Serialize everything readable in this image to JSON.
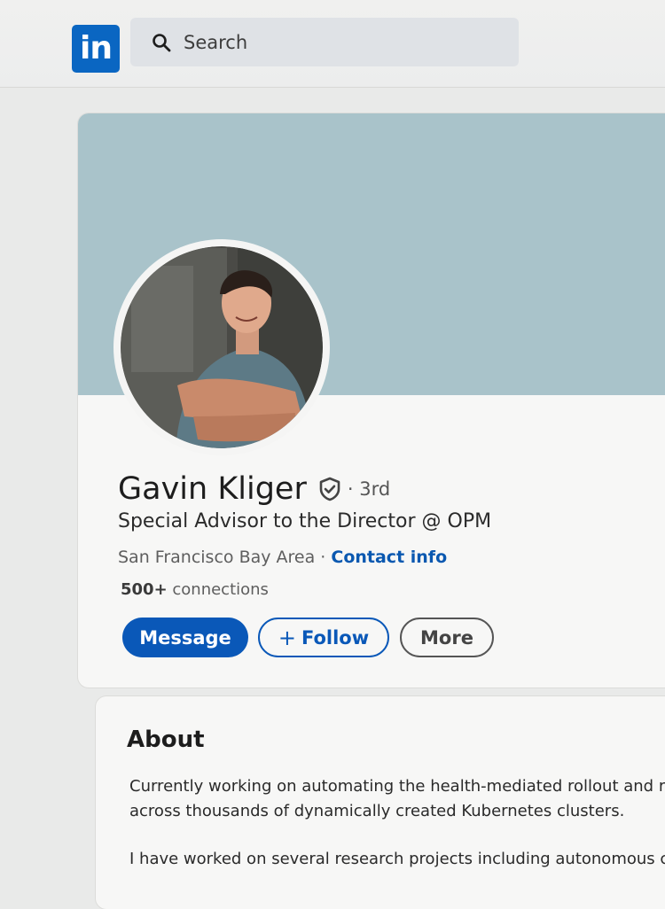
{
  "header": {
    "logo_text": "in",
    "search_placeholder": "Search"
  },
  "profile": {
    "name": "Gavin Kliger",
    "degree": "· 3rd",
    "headline": "Special Advisor to the Director @ OPM",
    "location": "San Francisco Bay Area",
    "separator": " · ",
    "contact_info": "Contact info",
    "connections_count": "500+",
    "connections_label": " connections",
    "actions": {
      "message": "Message",
      "follow": "Follow",
      "follow_icon": "+",
      "more": "More"
    }
  },
  "about": {
    "title": "About",
    "line1": "Currently working on automating the health-mediated rollout and r",
    "line2": "across thousands of dynamically created Kubernetes clusters.",
    "line3": "I have worked on several research projects including autonomous cl"
  },
  "colors": {
    "brand": "#0a66c2",
    "link": "#0a58b0",
    "banner": "#a9c3ca"
  },
  "icons": [
    "linkedin-logo",
    "search-icon",
    "verified-shield-icon",
    "plus-icon"
  ]
}
